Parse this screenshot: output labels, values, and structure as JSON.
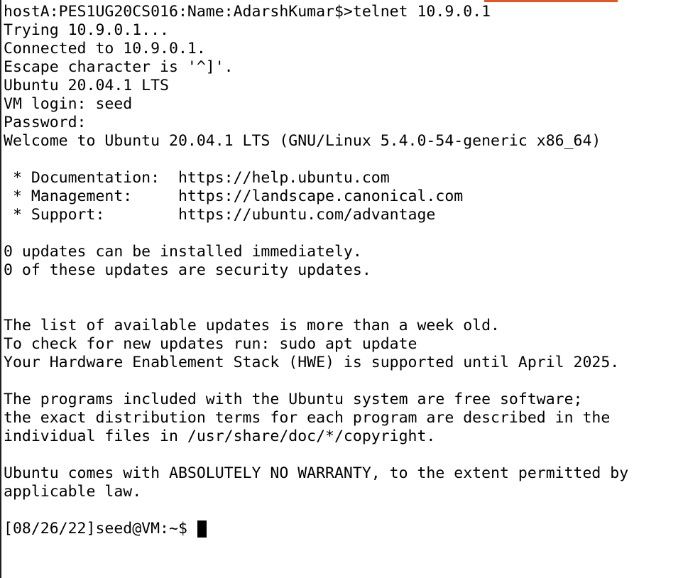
{
  "terminal": {
    "lines": [
      "hostA:PES1UG20CS016:Name:AdarshKumar$>telnet 10.9.0.1",
      "Trying 10.9.0.1...",
      "Connected to 10.9.0.1.",
      "Escape character is '^]'.",
      "Ubuntu 20.04.1 LTS",
      "VM login: seed",
      "Password:",
      "Welcome to Ubuntu 20.04.1 LTS (GNU/Linux 5.4.0-54-generic x86_64)",
      "",
      " * Documentation:  https://help.ubuntu.com",
      " * Management:     https://landscape.canonical.com",
      " * Support:        https://ubuntu.com/advantage",
      "",
      "0 updates can be installed immediately.",
      "0 of these updates are security updates.",
      "",
      "",
      "The list of available updates is more than a week old.",
      "To check for new updates run: sudo apt update",
      "Your Hardware Enablement Stack (HWE) is supported until April 2025.",
      "",
      "The programs included with the Ubuntu system are free software;",
      "the exact distribution terms for each program are described in the",
      "individual files in /usr/share/doc/*/copyright.",
      "",
      "Ubuntu comes with ABSOLUTELY NO WARRANTY, to the extent permitted by",
      "applicable law.",
      ""
    ],
    "prompt": "[08/26/22]seed@VM:~$ "
  },
  "colors": {
    "background": "#ffffff",
    "foreground": "#000000",
    "accent": "#e95420"
  }
}
